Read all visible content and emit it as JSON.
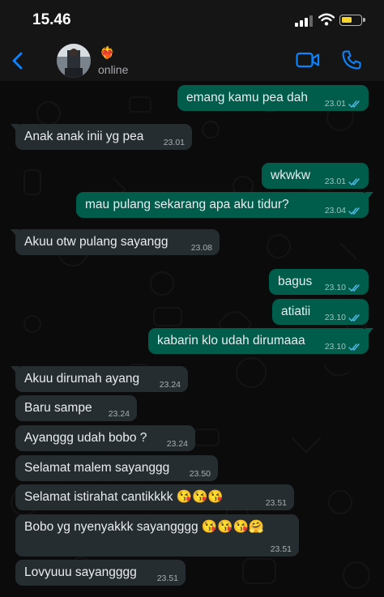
{
  "status_bar": {
    "time": "15.46"
  },
  "header": {
    "contact_status": "online",
    "heart_emoji": "❤️‍🔥"
  },
  "messages": [
    {
      "text": "emang kamu pea dah",
      "time": "23.01"
    },
    {
      "text": "Anak anak inii yg pea",
      "time": "23.01"
    },
    {
      "text": "wkwkw",
      "time": "23.01"
    },
    {
      "text": "mau pulang sekarang apa aku tidur?",
      "time": "23.04"
    },
    {
      "text": "Akuu otw pulang sayangg",
      "time": "23.08"
    },
    {
      "text": "bagus",
      "time": "23.10"
    },
    {
      "text": "atiatii",
      "time": "23.10"
    },
    {
      "text": "kabarin klo udah dirumaaa",
      "time": "23.10"
    },
    {
      "text": "Akuu dirumah ayang",
      "time": "23.24"
    },
    {
      "text": "Baru sampe",
      "time": "23.24"
    },
    {
      "text": "Ayanggg udah bobo ?",
      "time": "23.24"
    },
    {
      "text": "Selamat malem sayanggg",
      "time": "23.50"
    },
    {
      "text": "Selamat istirahat cantikkkk 😘😘😘",
      "time": "23.51"
    },
    {
      "text": "Bobo yg nyenyakkk sayangggg 😘😘😘🤗",
      "time": "23.51"
    },
    {
      "text": "Lovyuuu sayangggg",
      "time": "23.51"
    }
  ],
  "colors": {
    "incoming_bubble": "#262d31",
    "outgoing_bubble": "#005c4b",
    "accent": "#0a84ff",
    "read_ticks": "#53bdeb",
    "battery": "#f7d52d"
  },
  "icons": [
    "back-chevron-icon",
    "video-call-icon",
    "phone-icon",
    "wifi-icon",
    "signal-icon",
    "battery-icon",
    "double-check-icon"
  ]
}
